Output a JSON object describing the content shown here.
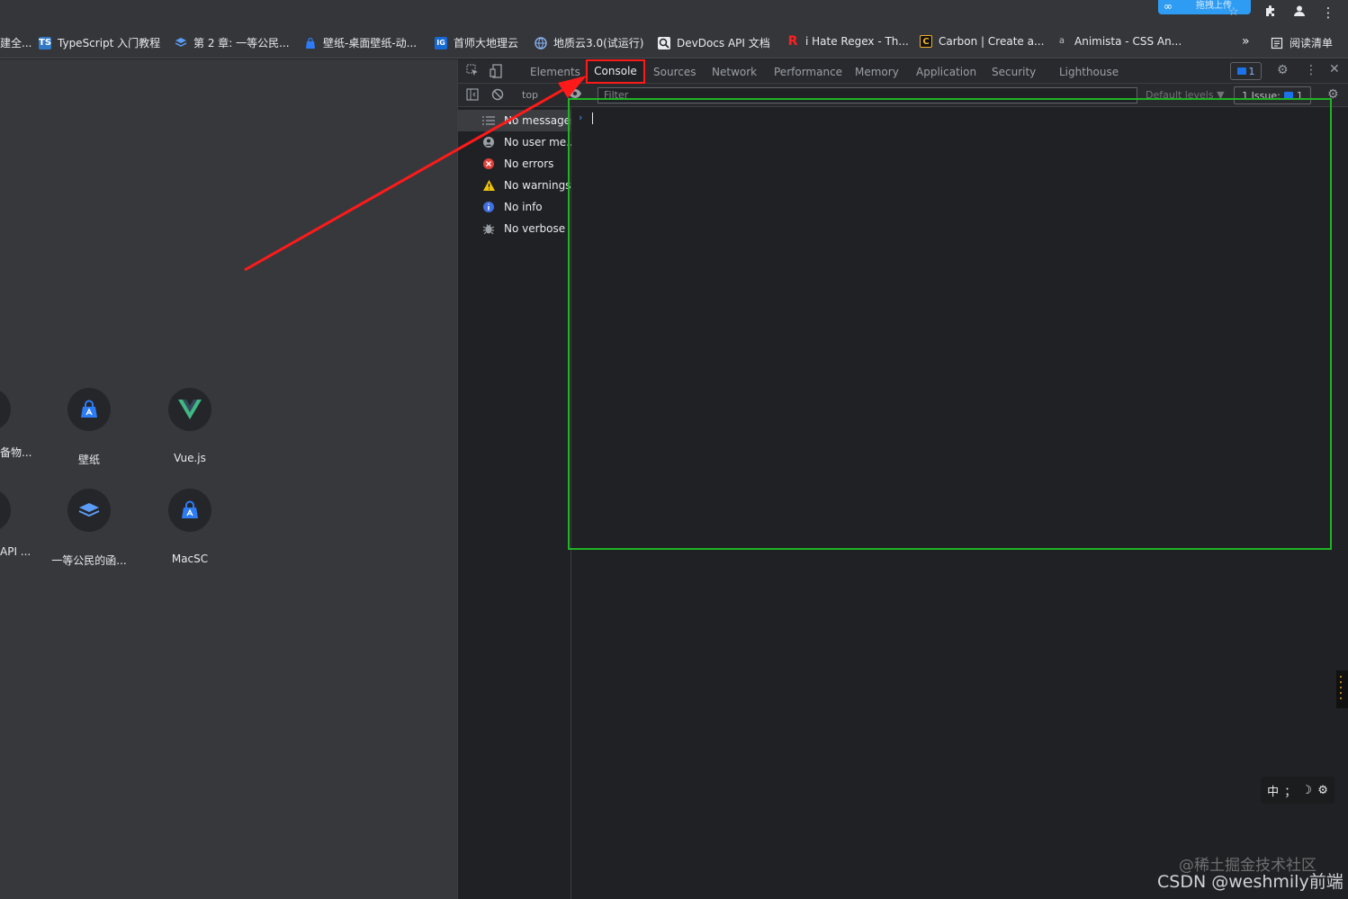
{
  "topbar": {
    "upload_label": "拖拽上传"
  },
  "bookmarks": {
    "items": [
      {
        "label": "建全...",
        "icon": "generic-bookmark-icon"
      },
      {
        "label": "TypeScript 入门教程",
        "icon_text": "TS",
        "icon_bg": "#3178c6"
      },
      {
        "label": "第 2 章: 一等公民...",
        "icon": "book-stack-icon",
        "icon_color": "#5b9df5"
      },
      {
        "label": "壁纸-桌面壁纸-动...",
        "icon": "app-store-icon",
        "icon_color": "#2d7cf6"
      },
      {
        "label": "首师大地理云",
        "icon_text": "IG",
        "icon_bg": "#1769d4"
      },
      {
        "label": "地质云3.0(试运行)",
        "icon": "globe-icon",
        "icon_color": "#8ab4f8"
      },
      {
        "label": "DevDocs API 文档",
        "icon": "devdocs-icon"
      },
      {
        "label": "i Hate Regex - Th...",
        "icon_text": "R",
        "icon_color": "#ff1f1f"
      },
      {
        "label": "Carbon | Create a...",
        "icon_text": "C",
        "icon_color": "#f0b02a"
      },
      {
        "label": "Animista - CSS An...",
        "icon_text": "a",
        "icon_color": "#bdc1c6"
      }
    ],
    "overflow_label": "»",
    "reading_list": "阅读清单"
  },
  "page": {
    "tiles": [
      {
        "label": "壁纸",
        "icon": "app-store-icon"
      },
      {
        "label": "Vue.js",
        "icon": "vue-logo-icon"
      },
      {
        "label": "一等公民的函...",
        "icon": "book-stack-icon"
      },
      {
        "label": "MacSC",
        "icon": "app-store-icon"
      }
    ],
    "partial_labels": [
      "备物...",
      "API ..."
    ]
  },
  "devtools": {
    "tabs": [
      "Elements",
      "Console",
      "Sources",
      "Network",
      "Performance",
      "Memory",
      "Application",
      "Security",
      "Lighthouse"
    ],
    "active_tab": "Console",
    "issues_count": "1",
    "console_toolbar": {
      "context": "top",
      "filter_placeholder": "Filter",
      "levels": "Default levels ▼",
      "issues_label": "1 Issue:",
      "issues_num": "1"
    },
    "sidebar": [
      {
        "label": "No messages",
        "icon": "list-icon",
        "color": "#9aa0a6"
      },
      {
        "label": "No user me...",
        "icon": "user-icon",
        "color": "#9aa0a6"
      },
      {
        "label": "No errors",
        "icon": "error-icon",
        "color": "#f28b82"
      },
      {
        "label": "No warnings",
        "icon": "warning-icon",
        "color": "#f2c40c"
      },
      {
        "label": "No info",
        "icon": "info-icon",
        "color": "#5c8df6"
      },
      {
        "label": "No verbose",
        "icon": "bug-icon",
        "color": "#9aa0a6"
      }
    ],
    "prompt_symbol": "›"
  },
  "ime": {
    "lang": "中",
    "punct": "；",
    "moon": "☽",
    "gear": "⚙"
  },
  "watermarks": [
    "@稀土掘金技术社区",
    "CSDN @weshmily前端"
  ],
  "colors": {
    "highlight_red": "#ff1a1a",
    "highlight_green": "#1fb424",
    "accent_blue": "#1a73e8"
  }
}
